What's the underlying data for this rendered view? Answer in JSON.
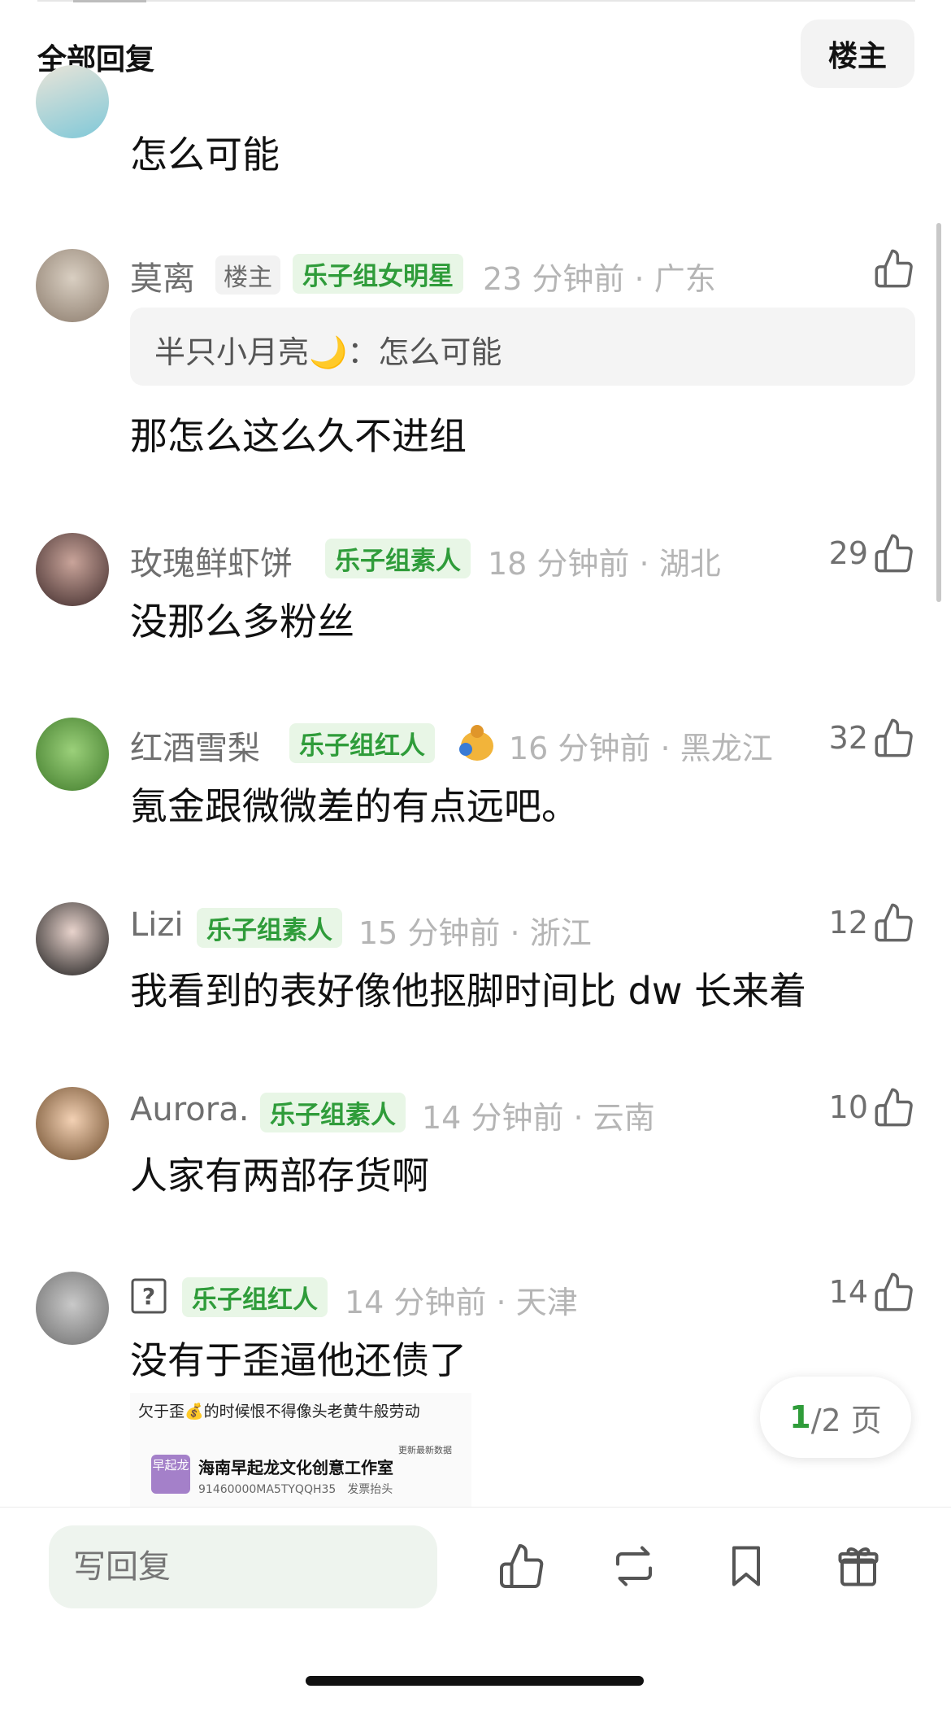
{
  "header": {
    "title": "全部回复",
    "owner_button": "楼主"
  },
  "partial_comment": {
    "body": "怎么可能"
  },
  "comments": [
    {
      "name": "莫离",
      "owner_tag": "楼主",
      "tag": "乐子组女明星",
      "time": "23 分钟前",
      "location": "广东",
      "quote_author": "半只小月亮🌙",
      "quote_text": "怎么可能",
      "body": "那怎么这么久不进组",
      "likes": ""
    },
    {
      "name": "玫瑰鲜虾饼",
      "tag": "乐子组素人",
      "time": "18 分钟前",
      "location": "湖北",
      "body": "没那么多粉丝",
      "likes": "29"
    },
    {
      "name": "红酒雪梨",
      "tag": "乐子组红人",
      "time": "16 分钟前",
      "location": "黑龙江",
      "body": "氪金跟微微差的有点远吧。",
      "likes": "32"
    },
    {
      "name": "Lizi",
      "tag": "乐子组素人",
      "time": "15 分钟前",
      "location": "浙江",
      "body": "我看到的表好像他抠脚时间比 dw 长来着",
      "likes": "12"
    },
    {
      "name": "Aurora.",
      "tag": "乐子组素人",
      "time": "14 分钟前",
      "location": "云南",
      "body": "人家有两部存货啊",
      "likes": "10"
    },
    {
      "name": "",
      "tag": "乐子组红人",
      "time": "14 分钟前",
      "location": "天津",
      "body": "没有于歪逼他还债了",
      "likes": "14"
    }
  ],
  "image_preview": {
    "caption": "欠于歪💰的时候恨不得像头老黄牛般劳动",
    "update_label": "更新最新数据",
    "logo_text": "早起龙",
    "company": "海南早起龙文化创意工作室",
    "code": "91460000MA5TYQQH35",
    "invoice_label": "发票抬头"
  },
  "pagination": {
    "current": "1",
    "total": "/2 页"
  },
  "bottom_bar": {
    "reply_placeholder": "写回复"
  },
  "colors": {
    "tag_green": "#2f9c3a",
    "tag_bg": "#e8f6e6",
    "meta_gray": "#b5b5b5"
  }
}
